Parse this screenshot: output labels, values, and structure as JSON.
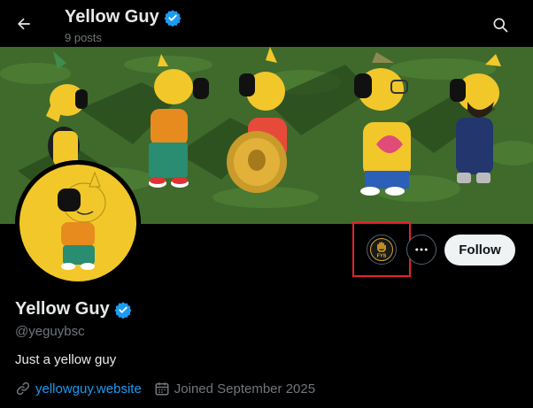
{
  "header": {
    "display_name": "Yellow Guy",
    "post_count": "9 posts"
  },
  "profile": {
    "display_name": "Yellow Guy",
    "handle": "@yeguybsc",
    "bio": "Just a yellow guy",
    "website": "yellowguy.website",
    "joined": "Joined September 2025",
    "verified": true
  },
  "actions": {
    "follow_label": "Follow",
    "badge_text": "FYS"
  },
  "colors": {
    "background": "#000000",
    "accent": "#1d9bf0",
    "verified": "#1d9bf0",
    "highlight": "#e0242e",
    "character_yellow": "#f2c72a",
    "banner_green": "#3f6a2c"
  },
  "icons": {
    "back": "arrow-left-icon",
    "search": "search-icon",
    "verified": "verified-badge-icon",
    "more": "ellipsis-icon",
    "link": "link-icon",
    "calendar": "calendar-icon"
  }
}
